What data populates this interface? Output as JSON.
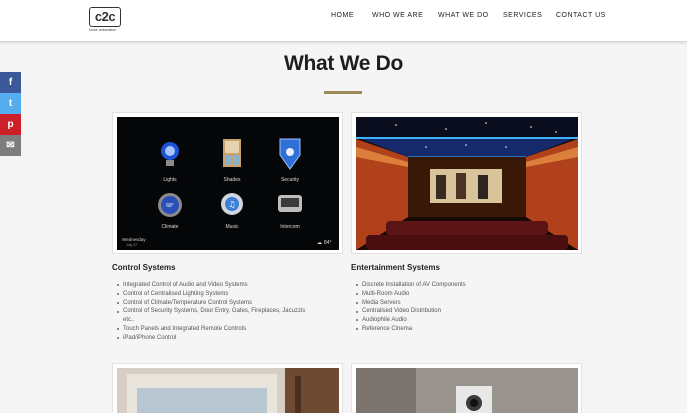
{
  "header": {
    "logo": {
      "mark": "c2c",
      "sub": "home automation"
    },
    "nav": [
      {
        "label": "HOME"
      },
      {
        "label": "WHO WE ARE"
      },
      {
        "label": "WHAT WE DO"
      },
      {
        "label": "SERVICES"
      },
      {
        "label": "CONTACT US"
      }
    ]
  },
  "social": [
    {
      "icon": "facebook-icon",
      "glyph": "f",
      "color": "#3b5998"
    },
    {
      "icon": "twitter-icon",
      "glyph": "t",
      "color": "#55acee"
    },
    {
      "icon": "pinterest-icon",
      "glyph": "p",
      "color": "#cb2027"
    },
    {
      "icon": "email-icon",
      "glyph": "✉",
      "color": "#7d7d7d"
    }
  ],
  "main": {
    "title": "What We Do",
    "accent_color": "#9c8a56",
    "touchpanel": {
      "tiles": [
        "Lights",
        "Shades",
        "Security",
        "Climate",
        "Music",
        "Intercom"
      ],
      "date_day": "Wednesday",
      "date_sub": "July 27",
      "temperature": "84°",
      "climate_reading": "68°"
    },
    "sections": [
      {
        "title": "Control Systems",
        "items": [
          "Integrated Control of Audio and Video Systems",
          "Control of Centralised Lighting Systems",
          "Control of Climate/Temperature Control Systems",
          "Control of Security Systems, Door Entry, Gates, Fireplaces, Jacuzzis",
          "etc..",
          "Touch Panels and Integrated Remote Controls",
          "iPad/iPhone Control"
        ]
      },
      {
        "title": "Entertainment Systems",
        "items": [
          "Discrete Installation of AV Components",
          "Multi-Room Audio",
          "Media Servers",
          "Centralised Video Distribution",
          "Audiophile Audio",
          "Reference Cinema"
        ]
      }
    ]
  }
}
